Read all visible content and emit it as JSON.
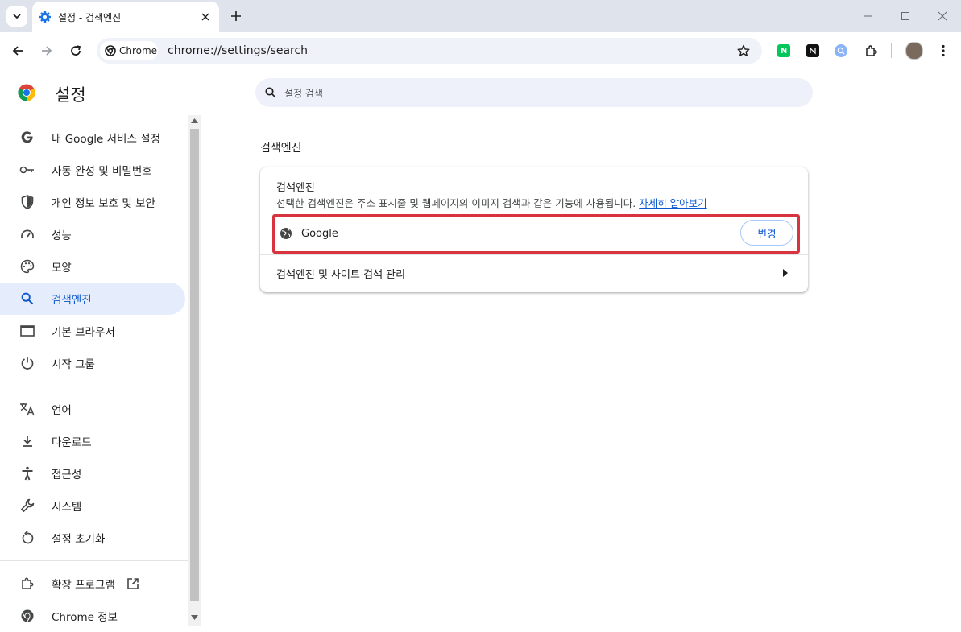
{
  "browser": {
    "tab_title": "설정 - 검색엔진",
    "url": "chrome://settings/search",
    "site_chip": "Chrome",
    "extensions": [
      "naver-icon",
      "notion-icon",
      "search-ext-icon",
      "puzzle-icon"
    ]
  },
  "header": {
    "title": "설정",
    "search_placeholder": "설정 검색"
  },
  "sidebar": {
    "items": [
      {
        "label": "내 Google 서비스 설정",
        "icon": "google-g-icon"
      },
      {
        "label": "자동 완성 및 비밀번호",
        "icon": "key-icon"
      },
      {
        "label": "개인 정보 보호 및 보안",
        "icon": "shield-icon"
      },
      {
        "label": "성능",
        "icon": "speedometer-icon"
      },
      {
        "label": "모양",
        "icon": "palette-icon"
      },
      {
        "label": "검색엔진",
        "icon": "search-icon",
        "active": true
      },
      {
        "label": "기본 브라우저",
        "icon": "browser-window-icon"
      },
      {
        "label": "시작 그룹",
        "icon": "power-icon"
      },
      {
        "label": "언어",
        "icon": "translate-icon"
      },
      {
        "label": "다운로드",
        "icon": "download-icon"
      },
      {
        "label": "접근성",
        "icon": "accessibility-icon"
      },
      {
        "label": "시스템",
        "icon": "wrench-icon"
      },
      {
        "label": "설정 초기화",
        "icon": "reset-icon"
      },
      {
        "label": "확장 프로그램",
        "icon": "puzzle-icon"
      },
      {
        "label": "Chrome 정보",
        "icon": "chrome-icon"
      }
    ]
  },
  "main": {
    "section_title": "검색엔진",
    "card": {
      "title": "검색엔진",
      "description": "선택한 검색엔진은 주소 표시줄 및 웹페이지의 이미지 검색과 같은 기능에 사용됩니다.",
      "learn_more": "자세히 알아보기",
      "engine_name": "Google",
      "change_label": "변경",
      "manage_label": "검색엔진 및 사이트 검색 관리"
    }
  },
  "colors": {
    "accent": "#0b57d0",
    "active_nav_bg": "#e5ecfb",
    "highlight_border": "#d8343f"
  }
}
